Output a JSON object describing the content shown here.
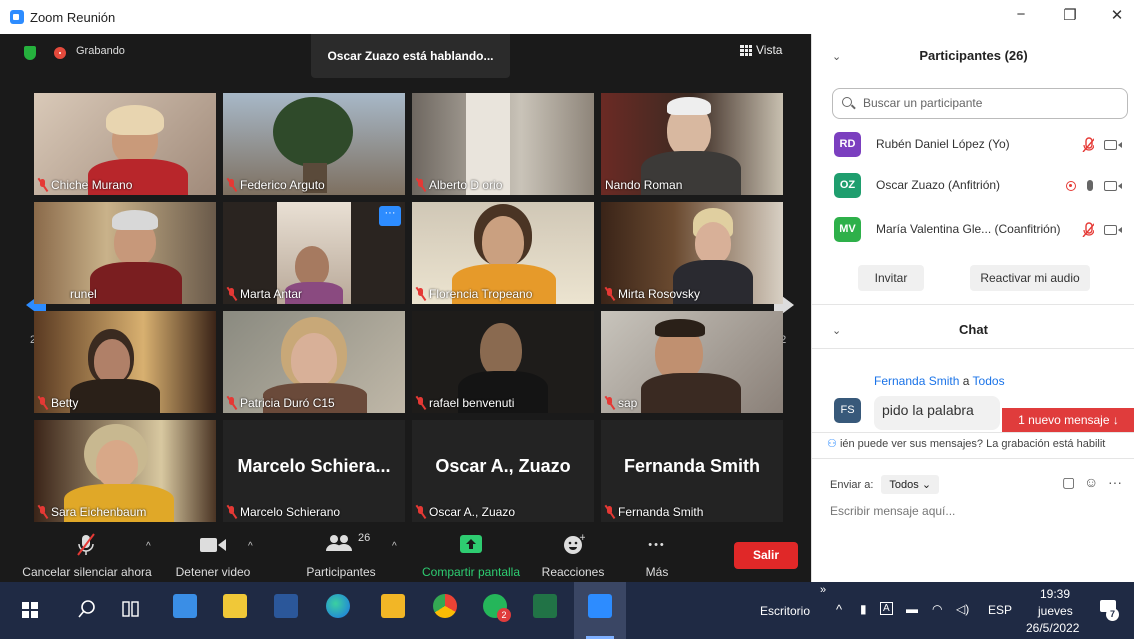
{
  "window": {
    "title": "Zoom Reunión",
    "minimize": "−",
    "maximize": "❐",
    "close": "✕"
  },
  "meeting": {
    "recording_label": "Grabando",
    "speaking_banner": "Oscar Zuazo está hablando...",
    "view_label": "Vista",
    "page_left": "2/2",
    "page_right": "2/2"
  },
  "tiles": [
    {
      "name": "Chiche Murano",
      "muted": true
    },
    {
      "name": "Federico Arguto",
      "muted": true
    },
    {
      "name": "Alberto D orio",
      "muted": true
    },
    {
      "name": "Nando Roman",
      "muted": false
    },
    {
      "name": "runel",
      "muted": false
    },
    {
      "name": "Marta Antar",
      "muted": true
    },
    {
      "name": "Florencia Tropeano",
      "muted": true
    },
    {
      "name": "Mirta Rosovsky",
      "muted": true
    },
    {
      "name": "Betty",
      "muted": true
    },
    {
      "name": "Patricia Duró C15",
      "muted": true
    },
    {
      "name": "rafael benvenuti",
      "muted": true
    },
    {
      "name": "sap",
      "muted": true
    },
    {
      "name": "Sara Eichenbaum",
      "muted": true
    },
    {
      "name": "Marcelo Schierano",
      "big_name": "Marcelo  Schiera...",
      "muted": true
    },
    {
      "name": "Oscar A., Zuazo",
      "big_name": "Oscar A., Zuazo",
      "muted": true
    },
    {
      "name": "Fernanda Smith",
      "big_name": "Fernanda Smith",
      "muted": true
    }
  ],
  "toolbar": {
    "unmute_label": "Cancelar silenciar ahora",
    "video_label": "Detener video",
    "participants_label": "Participantes",
    "participants_count": "26",
    "share_label": "Compartir pantalla",
    "reactions_label": "Reacciones",
    "more_label": "Más",
    "more_dots": "•••",
    "leave_label": "Salir"
  },
  "participants_panel": {
    "title": "Participantes (26)",
    "search_placeholder": "Buscar un participante",
    "list": [
      {
        "initials": "RD",
        "name": "Rubén Daniel López (Yo)",
        "color": "#7b3fbf"
      },
      {
        "initials": "OZ",
        "name": "Oscar Zuazo (Anfitrión)",
        "color": "#1f9e6e"
      },
      {
        "initials": "MV",
        "name": "María Valentina Gle... (Coanfitrión)",
        "color": "#2eb04a"
      }
    ],
    "invite_label": "Invitar",
    "unmute_me_label": "Reactivar mi audio"
  },
  "chat": {
    "title": "Chat",
    "sender": "Fernanda Smith",
    "to_word": "a",
    "recipient": "Todos",
    "sender_initials": "FS",
    "message": "pido la palabra",
    "new_message_badge": "1 nuevo mensaje ↓",
    "notice": "ién puede ver sus mensajes? La grabación está habilit",
    "send_to_label": "Enviar a:",
    "send_to_value": "Todos",
    "compose_placeholder": "Escribir mensaje aquí..."
  },
  "taskbar": {
    "desktop_label": "Escritorio",
    "language": "ESP",
    "time": "19:39",
    "day": "jueves",
    "date": "26/5/2022",
    "chevron": "»",
    "notification_count": "7",
    "chat_badge": "2"
  }
}
